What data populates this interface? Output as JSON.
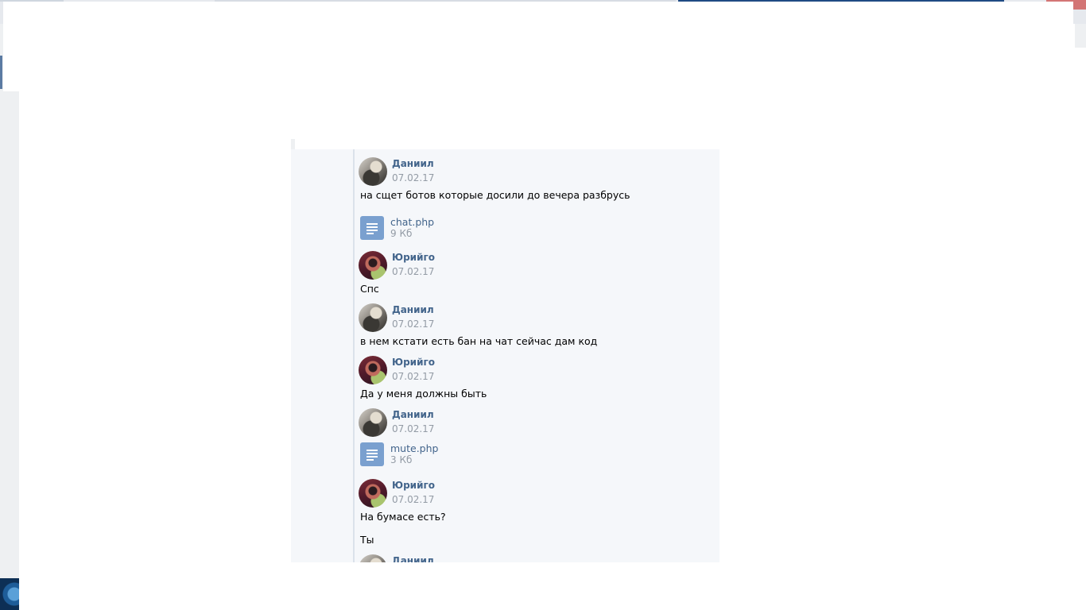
{
  "chat": {
    "messages": [
      {
        "author": "Даниил",
        "date": "07.02.17",
        "avatar": "avatar-daniil",
        "text": "на сщет ботов которые досили до вечера разбрусь",
        "attachment": {
          "name": "chat.php",
          "size": "9 Кб",
          "icon": "document-icon"
        }
      },
      {
        "author": "Юрийго",
        "date": "07.02.17",
        "avatar": "avatar-yuriygo",
        "text": "Спс"
      },
      {
        "author": "Даниил",
        "date": "07.02.17",
        "avatar": "avatar-daniil",
        "text": "в нем кстати есть бан на чат сейчас дам код"
      },
      {
        "author": "Юрийго",
        "date": "07.02.17",
        "avatar": "avatar-yuriygo",
        "text": "Да у меня должны быть"
      },
      {
        "author": "Даниил",
        "date": "07.02.17",
        "avatar": "avatar-daniil",
        "attachment": {
          "name": "mute.php",
          "size": "3 Кб",
          "icon": "document-icon"
        }
      },
      {
        "author": "Юрийго",
        "date": "07.02.17",
        "avatar": "avatar-yuriygo",
        "text": "На бумасе есть?",
        "text2": "Ты"
      },
      {
        "author": "Даниил",
        "avatar": "avatar-daniil"
      }
    ]
  },
  "colors": {
    "link": "#42648b",
    "muted": "#939ba5",
    "panel_bg": "#f5f7fa",
    "doc_icon": "#7aa0cf"
  }
}
